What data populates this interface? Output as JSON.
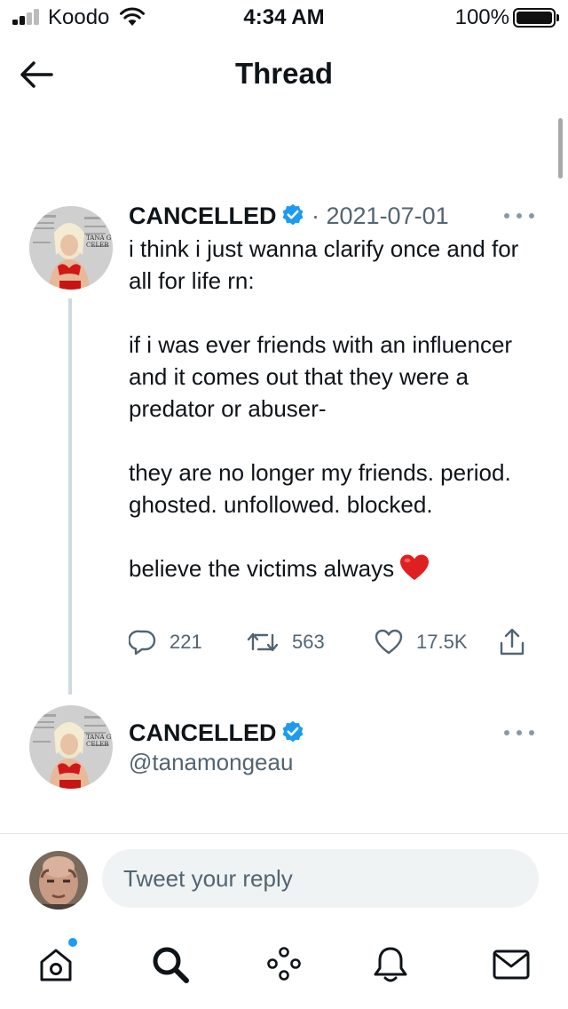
{
  "status_bar": {
    "carrier": "Koodo",
    "time": "4:34 AM",
    "battery_percent": "100%"
  },
  "header": {
    "title": "Thread"
  },
  "tweets": [
    {
      "display_name": "CANCELLED",
      "date_separator": " · ",
      "date": "2021-07-01",
      "body": [
        "i think i just wanna clarify once and for all for life rn:",
        "if i was ever friends with an influencer and it comes out that they were a predator or abuser-",
        "they are no longer my friends. period. ghosted. unfollowed. blocked.",
        "believe the victims always"
      ],
      "stats": {
        "replies": "221",
        "retweets": "563",
        "likes": "17.5K"
      }
    },
    {
      "display_name": "CANCELLED",
      "handle": "@tanamongeau"
    }
  ],
  "reply": {
    "placeholder": "Tweet your reply"
  },
  "tab_bar": [
    "home-icon",
    "search-icon",
    "spaces-icon",
    "notifications-icon",
    "messages-icon"
  ],
  "colors": {
    "accent": "#1d9bf0",
    "text": "#0f1419",
    "secondary": "#536471",
    "thread_line": "#cfd9de",
    "heart": "#e0245e"
  }
}
